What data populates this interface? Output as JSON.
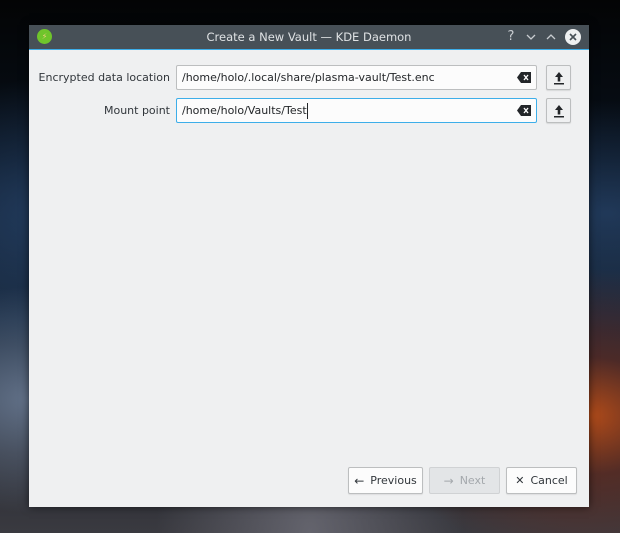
{
  "window": {
    "title": "Create a New Vault — KDE Daemon",
    "app_icon": "kde-daemon-icon",
    "titlebar_buttons": {
      "help": "?",
      "minimize": "⌄",
      "maximize": "⌃",
      "close": "✕"
    }
  },
  "form": {
    "fields": [
      {
        "label": "Encrypted data location",
        "value": "/home/holo/.local/share/plasma-vault/Test.enc",
        "focused": false,
        "clear_icon": "clear-text-icon",
        "browse_icon": "upload-icon"
      },
      {
        "label": "Mount point",
        "value": "/home/holo/Vaults/Test",
        "focused": true,
        "clear_icon": "clear-text-icon",
        "browse_icon": "upload-icon"
      }
    ]
  },
  "footer": {
    "previous": {
      "label": "Previous",
      "icon": "←",
      "enabled": true
    },
    "next": {
      "label": "Next",
      "icon": "→",
      "enabled": false
    },
    "cancel": {
      "label": "Cancel",
      "icon": "✕",
      "enabled": true
    }
  },
  "colors": {
    "accent": "#3daee9",
    "titlebar": "#475057",
    "window_bg": "#eff0f1",
    "app_icon": "#6fc52b"
  }
}
